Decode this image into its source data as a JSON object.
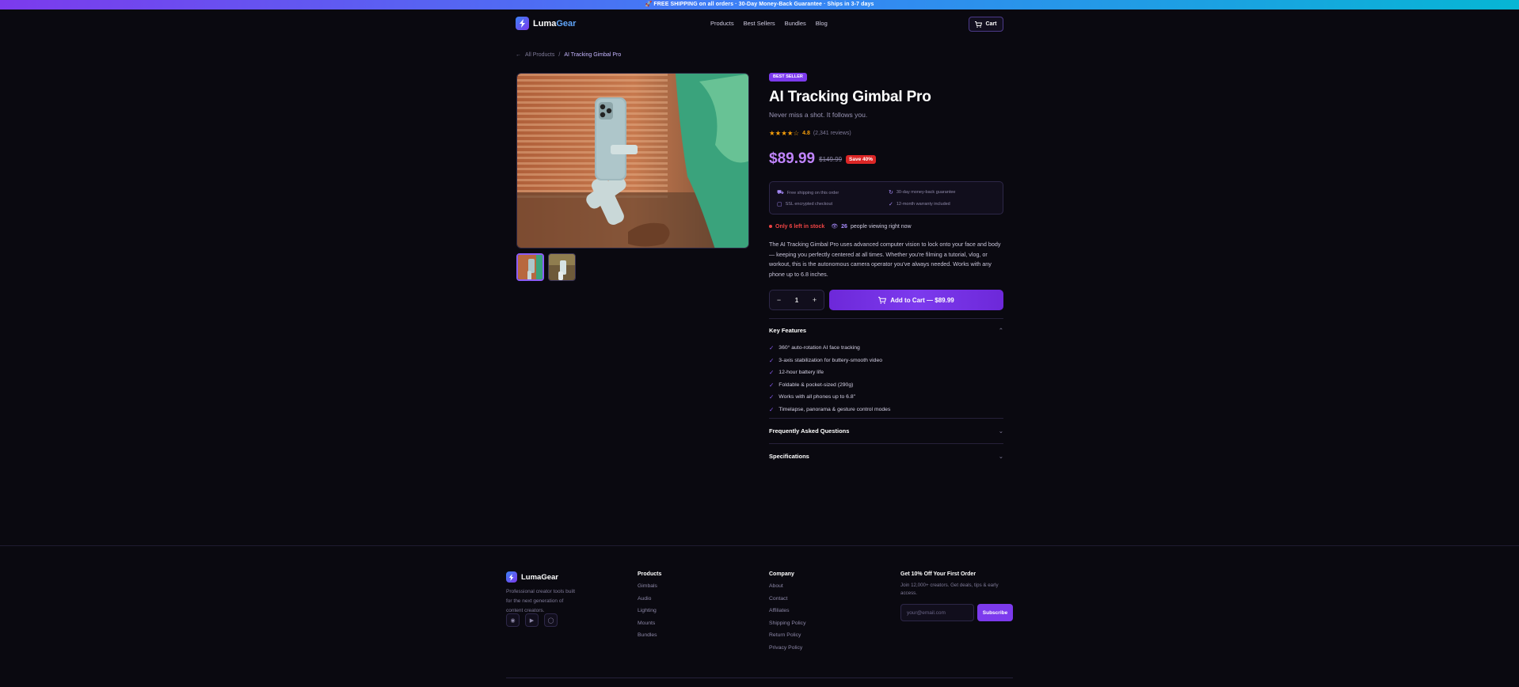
{
  "announcement": "🚀 FREE SHIPPING on all orders · 30-Day Money-Back Guarantee · Ships in 3-7 days",
  "brand": {
    "name_a": "Luma",
    "name_b": "Gear"
  },
  "nav": {
    "items": [
      "Products",
      "Best Sellers",
      "Bundles",
      "Blog"
    ],
    "cart_label": "Cart"
  },
  "breadcrumb": {
    "back": "All Products",
    "sep": "/",
    "current": "AI Tracking Gimbal Pro"
  },
  "product": {
    "badge": "BEST SELLER",
    "title": "AI Tracking Gimbal Pro",
    "tagline": "Never miss a shot. It follows you.",
    "stars": "★★★★☆",
    "rating": "4.8",
    "reviews": "(2,341 reviews)",
    "price": "$89.99",
    "old_price": "$149.99",
    "save": "Save 40%",
    "trust": [
      "Free shipping on this order",
      "30-day money-back guarantee",
      "SSL encrypted checkout",
      "12-month warranty included"
    ],
    "stock_low": "Only 6 left in stock",
    "viewers": "26",
    "viewers_label": "people viewing right now",
    "description": "The AI Tracking Gimbal Pro uses advanced computer vision to lock onto your face and body — keeping you perfectly centered at all times. Whether you're filming a tutorial, vlog, or workout, this is the autonomous camera operator you've always needed. Works with any phone up to 6.8 inches.",
    "qty": "1",
    "qty_minus": "−",
    "qty_plus": "+",
    "add_to_cart": "Add to Cart — $89.99"
  },
  "accordion": {
    "features_title": "Key Features",
    "features": [
      "360° auto-rotation AI face tracking",
      "3-axis stabilization for buttery-smooth video",
      "12-hour battery life",
      "Foldable & pocket-sized (290g)",
      "Works with all phones up to 6.8\"",
      "Timelapse, panorama & gesture control modes"
    ],
    "faq_title": "Frequently Asked Questions",
    "specs_title": "Specifications"
  },
  "footer": {
    "brand": "LumaGear",
    "about": "Professional creator tools built for the next generation of content creators.",
    "products_title": "Products",
    "products": [
      "Gimbals",
      "Audio",
      "Lighting",
      "Mounts",
      "Bundles"
    ],
    "company_title": "Company",
    "company": [
      "About",
      "Contact",
      "Affiliates",
      "Shipping Policy",
      "Return Policy",
      "Privacy Policy"
    ],
    "news_title": "Get 10% Off Your First Order",
    "news_text": "Join 12,000+ creators. Get deals, tips & early access.",
    "email_placeholder": "your@email.com",
    "subscribe": "Subscribe"
  },
  "colors": {
    "accent": "#7c3aed",
    "price": "#c084fc",
    "stars": "#f59e0b",
    "alert": "#ef4444"
  }
}
